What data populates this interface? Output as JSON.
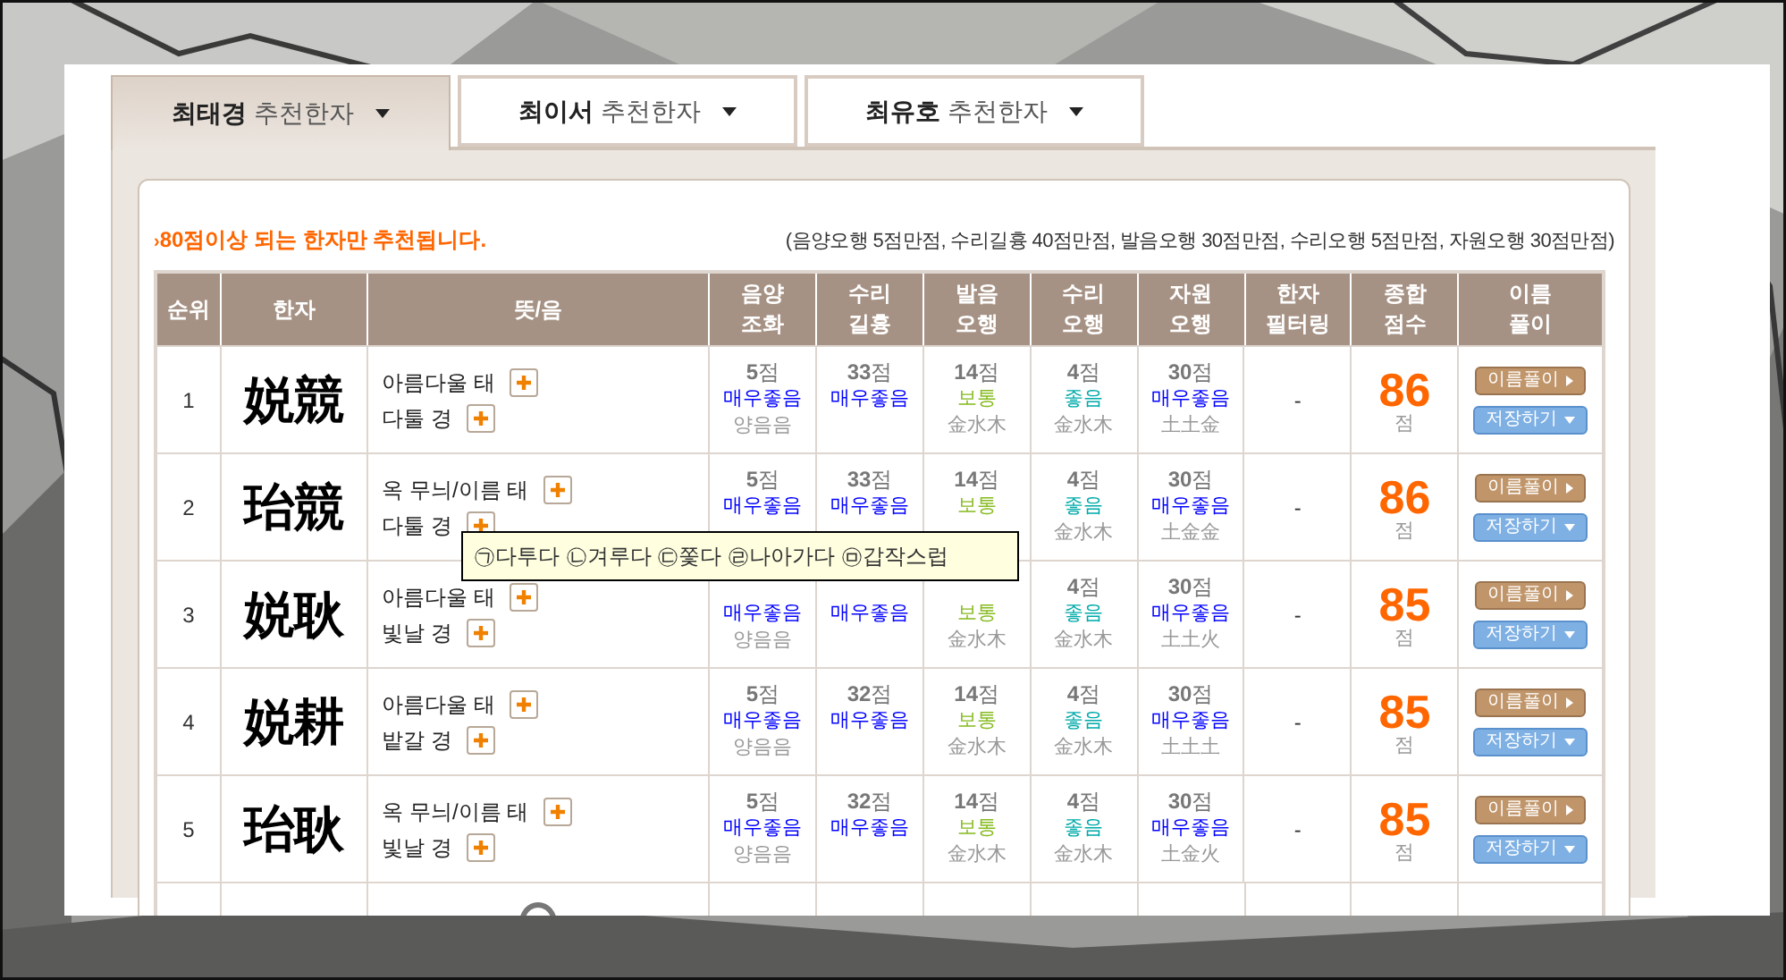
{
  "tabs": [
    {
      "name": "최태경",
      "suffix": "추천한자",
      "selected": true
    },
    {
      "name": "최이서",
      "suffix": "추천한자",
      "selected": false
    },
    {
      "name": "최유호",
      "suffix": "추천한자",
      "selected": false
    }
  ],
  "notice": {
    "marker": "›",
    "text": "80점이상 되는 한자만 추천됩니다.",
    "criteria": "(음양오행 5점만점, 수리길흉 40점만점, 발음오행 30점만점, 수리오행 5점만점, 자원오행 30점만점)"
  },
  "table": {
    "columns": [
      "순위",
      "한자",
      "뜻/음",
      "음양\n조화",
      "수리\n길흉",
      "발음\n오행",
      "수리\n오행",
      "자원\n오행",
      "한자\n필터링",
      "종합\n점수",
      "이름\n풀이"
    ],
    "rows": [
      {
        "rank": "1",
        "hanja": "娧競",
        "meanings": [
          "아름다울 태",
          "다툴 경"
        ],
        "scores": [
          {
            "score": "5",
            "unit": "점",
            "rating": "매우좋음",
            "color": "#0000ff",
            "elements": "양음음"
          },
          {
            "score": "33",
            "unit": "점",
            "rating": "매우좋음",
            "color": "#0000ff"
          },
          {
            "score": "14",
            "unit": "점",
            "rating": "보통",
            "color": "#88bb22",
            "elements": "金水木"
          },
          {
            "score": "4",
            "unit": "점",
            "rating": "좋음",
            "color": "#00aaaa",
            "elements": "金水木"
          },
          {
            "score": "30",
            "unit": "점",
            "rating": "매우좋음",
            "color": "#0000ff",
            "elements": "土土金"
          }
        ],
        "filtering": "-",
        "total": "86",
        "total_unit": "점",
        "buttons": [
          "이름풀이",
          "저장하기"
        ]
      },
      {
        "rank": "2",
        "hanja": "珆競",
        "meanings": [
          "옥 무늬/이름 태",
          "다툴 경"
        ],
        "scores": [
          {
            "score": "5",
            "unit": "점",
            "rating": "매우좋음",
            "color": "#0000ff"
          },
          {
            "score": "33",
            "unit": "점",
            "rating": "매우좋음",
            "color": "#0000ff"
          },
          {
            "score": "14",
            "unit": "점",
            "rating": "보통",
            "color": "#88bb22"
          },
          {
            "score": "4",
            "unit": "점",
            "rating": "좋음",
            "color": "#00aaaa",
            "elements": "金水木"
          },
          {
            "score": "30",
            "unit": "점",
            "rating": "매우좋음",
            "color": "#0000ff",
            "elements": "土金金"
          }
        ],
        "filtering": "-",
        "total": "86",
        "total_unit": "점",
        "buttons": [
          "이름풀이",
          "저장하기"
        ]
      },
      {
        "rank": "3",
        "hanja": "娧耿",
        "meanings": [
          "아름다울 태",
          "빛날 경"
        ],
        "scores": [
          {
            "rating": "매우좋음",
            "color": "#0000ff",
            "elements": "양음음"
          },
          {
            "rating": "매우좋음",
            "color": "#0000ff"
          },
          {
            "rating": "보통",
            "color": "#88bb22",
            "elements": "金水木"
          },
          {
            "score": "4",
            "unit": "점",
            "rating": "좋음",
            "color": "#00aaaa",
            "elements": "金水木"
          },
          {
            "score": "30",
            "unit": "점",
            "rating": "매우좋음",
            "color": "#0000ff",
            "elements": "土土火"
          }
        ],
        "filtering": "-",
        "total": "85",
        "total_unit": "점",
        "buttons": [
          "이름풀이",
          "저장하기"
        ]
      },
      {
        "rank": "4",
        "hanja": "娧耕",
        "meanings": [
          "아름다울 태",
          "밭갈 경"
        ],
        "scores": [
          {
            "score": "5",
            "unit": "점",
            "rating": "매우좋음",
            "color": "#0000ff",
            "elements": "양음음"
          },
          {
            "score": "32",
            "unit": "점",
            "rating": "매우좋음",
            "color": "#0000ff"
          },
          {
            "score": "14",
            "unit": "점",
            "rating": "보통",
            "color": "#88bb22",
            "elements": "金水木"
          },
          {
            "score": "4",
            "unit": "점",
            "rating": "좋음",
            "color": "#00aaaa",
            "elements": "金水木"
          },
          {
            "score": "30",
            "unit": "점",
            "rating": "매우좋음",
            "color": "#0000ff",
            "elements": "土土土"
          }
        ],
        "filtering": "-",
        "total": "85",
        "total_unit": "점",
        "buttons": [
          "이름풀이",
          "저장하기"
        ]
      },
      {
        "rank": "5",
        "hanja": "珆耿",
        "meanings": [
          "옥 무늬/이름 태",
          "빛날 경"
        ],
        "scores": [
          {
            "score": "5",
            "unit": "점",
            "rating": "매우좋음",
            "color": "#0000ff",
            "elements": "양음음"
          },
          {
            "score": "32",
            "unit": "점",
            "rating": "매우좋음",
            "color": "#0000ff"
          },
          {
            "score": "14",
            "unit": "점",
            "rating": "보통",
            "color": "#88bb22",
            "elements": "金水木"
          },
          {
            "score": "4",
            "unit": "점",
            "rating": "좋음",
            "color": "#00aaaa",
            "elements": "金水木"
          },
          {
            "score": "30",
            "unit": "점",
            "rating": "매우좋음",
            "color": "#0000ff",
            "elements": "土金火"
          }
        ],
        "filtering": "-",
        "total": "85",
        "total_unit": "점",
        "buttons": [
          "이름풀이",
          "저장하기"
        ]
      }
    ]
  },
  "tooltip": {
    "text": "㉠다투다 ㉡겨루다 ㉢쫓다 ㉣나아가다 ㉤갑작스럽"
  }
}
